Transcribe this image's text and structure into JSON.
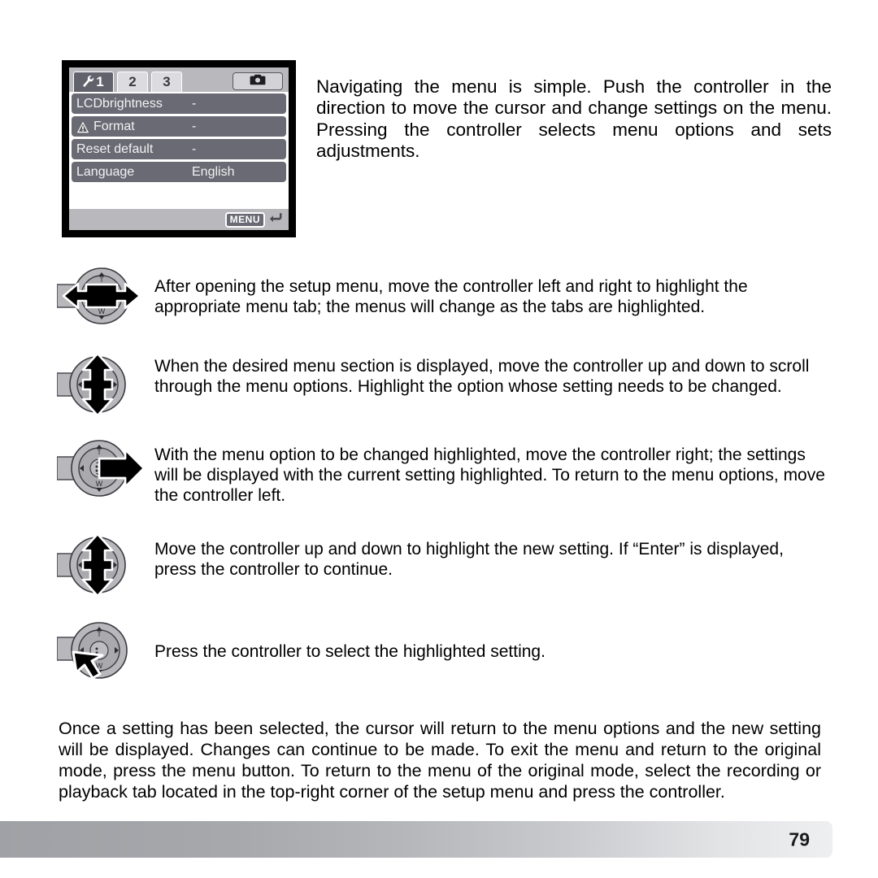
{
  "lcd_screen": {
    "tabs": [
      {
        "name": "setup-tab-1",
        "label": "1",
        "icon": "wrench-icon",
        "active": true
      },
      {
        "name": "setup-tab-2",
        "label": "2",
        "active": false
      },
      {
        "name": "setup-tab-3",
        "label": "3",
        "active": false
      }
    ],
    "mode_tab": {
      "name": "camera-mode-tab",
      "icon": "camera-icon",
      "label": ""
    },
    "menu_rows": [
      {
        "label": "LCDbrightness",
        "value": "-",
        "icon": ""
      },
      {
        "label": "Format",
        "value": "-",
        "icon": "warning-triangle-icon"
      },
      {
        "label": "Reset default",
        "value": "-",
        "icon": ""
      },
      {
        "label": "Language",
        "value": "English",
        "icon": ""
      }
    ],
    "footer": {
      "menu_label": "MENU",
      "back_arrow": "↰"
    }
  },
  "intro": {
    "text": "Navigating the menu is simple. Push the controller in the direction to move the cursor and change settings on the menu. Pressing the controller selects menu options and sets adjustments."
  },
  "steps": [
    {
      "icon": "controller-left-right-icon",
      "text": "After opening the setup menu, move the controller left and right to highlight the appropriate menu tab; the menus will change as the tabs are highlighted."
    },
    {
      "icon": "controller-up-down-icon",
      "text": "When the desired menu section is displayed, move the controller up and down to scroll through the menu options. Highlight the option whose setting needs to be changed."
    },
    {
      "icon": "controller-right-icon",
      "text": "With the menu option to be changed highlighted, move the controller right; the settings will be displayed with the current setting highlighted. To return to the menu options, move the controller left."
    },
    {
      "icon": "controller-up-down-icon",
      "text": "Move the controller up and down to highlight the new setting. If “Enter” is displayed, press the controller to continue."
    },
    {
      "icon": "controller-press-icon",
      "text": "Press the controller to select the highlighted setting."
    }
  ],
  "closing": {
    "text": "Once a setting has been selected, the cursor will return to the menu options and the new setting will be displayed. Changes can continue to be made. To exit the menu and return to the original mode, press the menu button. To return to the menu of the original mode, select the recording or playback tab located in the top-right corner of the setup menu and press the controller."
  },
  "footer": {
    "page_number": "79"
  },
  "colors": {
    "lcd_bezel": "#000000",
    "lcd_row": "#6a6a74",
    "lcd_tabbar": "#b9b9bd",
    "tab_active": "#62626c",
    "tab_inactive": "#dcdce0",
    "controller_body": "#b0b0b4",
    "arrow": "#000000"
  }
}
